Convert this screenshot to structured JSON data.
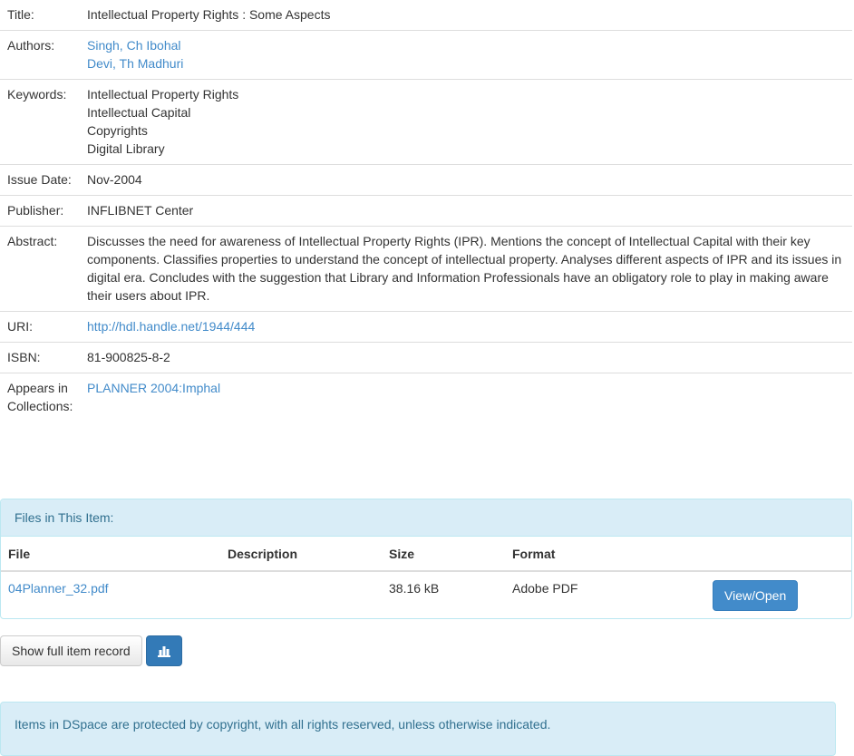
{
  "metadata": {
    "title_label": "Title:",
    "title_value": "Intellectual Property Rights : Some Aspects",
    "authors_label": "Authors:",
    "authors": [
      "Singh, Ch Ibohal",
      "Devi, Th Madhuri"
    ],
    "keywords_label": "Keywords:",
    "keywords": [
      "Intellectual Property Rights",
      "Intellectual Capital",
      "Copyrights",
      "Digital Library"
    ],
    "issue_date_label": "Issue Date:",
    "issue_date": "Nov-2004",
    "publisher_label": "Publisher:",
    "publisher": "INFLIBNET Center",
    "abstract_label": "Abstract:",
    "abstract": "Discusses the need for awareness of Intellectual Property Rights (IPR). Mentions the concept of Intellectual Capital with their key components. Classifies properties to understand the concept of intellectual property. Analyses different aspects of IPR and its issues in digital era. Concludes with the suggestion that Library and Information Professionals have an obligatory role to play in making aware their users about IPR.",
    "uri_label": "URI:",
    "uri": "http://hdl.handle.net/1944/444",
    "isbn_label": "ISBN:",
    "isbn": "81-900825-8-2",
    "collections_label": "Appears in Collections:",
    "collection": "PLANNER 2004:Imphal"
  },
  "files": {
    "heading": "Files in This Item:",
    "columns": [
      "File",
      "Description",
      "Size",
      "Format"
    ],
    "rows": [
      {
        "file": "04Planner_32.pdf",
        "description": "",
        "size": "38.16 kB",
        "format": "Adobe PDF",
        "action": "View/Open"
      }
    ]
  },
  "actions": {
    "show_full_record": "Show full item record",
    "stats_icon": "bar-chart-icon"
  },
  "footer_note": "Items in DSpace are protected by copyright, with all rights reserved, unless otherwise indicated.",
  "colors": {
    "link": "#428bca",
    "primary": "#428bca",
    "info_bg": "#d9edf7",
    "info_text": "#31708f"
  }
}
